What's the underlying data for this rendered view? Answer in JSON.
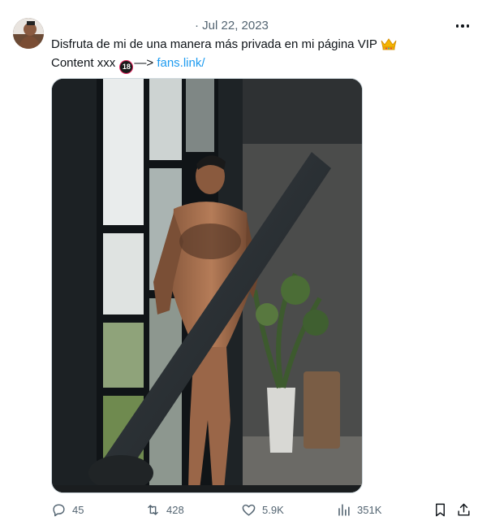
{
  "tweet": {
    "date_line": "· Jul 22, 2023",
    "line1": "Disfruta de mi de una manera más privada en mi página VIP",
    "line2_prefix": "Content xxx",
    "badge": "18",
    "arrow": "—>",
    "link": "fans.link/"
  },
  "actions": {
    "replies": "45",
    "reposts": "428",
    "likes": "5.9K",
    "views": "351K"
  },
  "colors": {
    "text": "#0f1419",
    "secondary": "#536471",
    "link": "#1d9bf0"
  },
  "icons": [
    "avatar",
    "more-dots-icon",
    "crown-emoji-icon",
    "eighteen-badge-icon",
    "reply-icon",
    "repost-icon",
    "like-icon",
    "views-icon",
    "bookmark-icon",
    "share-icon"
  ]
}
